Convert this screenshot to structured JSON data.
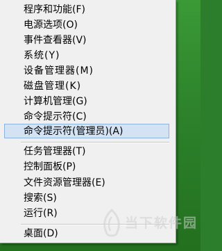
{
  "menu": {
    "items": [
      {
        "label": "程序和功能(F)"
      },
      {
        "label": "电源选项(O)"
      },
      {
        "label": "事件查看器(V)"
      },
      {
        "label": "系统(Y)"
      },
      {
        "label": "设备管理器(M)"
      },
      {
        "label": "磁盘管理(K)"
      },
      {
        "label": "计算机管理(G)"
      },
      {
        "label": "命令提示符(C)"
      },
      {
        "label": "命令提示符(管理员)(A)"
      },
      {
        "label": "任务管理器(T)"
      },
      {
        "label": "控制面板(P)"
      },
      {
        "label": "文件资源管理器(E)"
      },
      {
        "label": "搜索(S)"
      },
      {
        "label": "运行(R)"
      },
      {
        "label": "桌面(D)"
      }
    ],
    "highlighted_index": 8,
    "highlight_color": "#d4e3f3"
  },
  "watermark": {
    "text": "当下软件园",
    "icon": "danji-logo-icon"
  },
  "colors": {
    "desktop": "#2c7d2c",
    "menu_background": "#f0f0f0"
  }
}
